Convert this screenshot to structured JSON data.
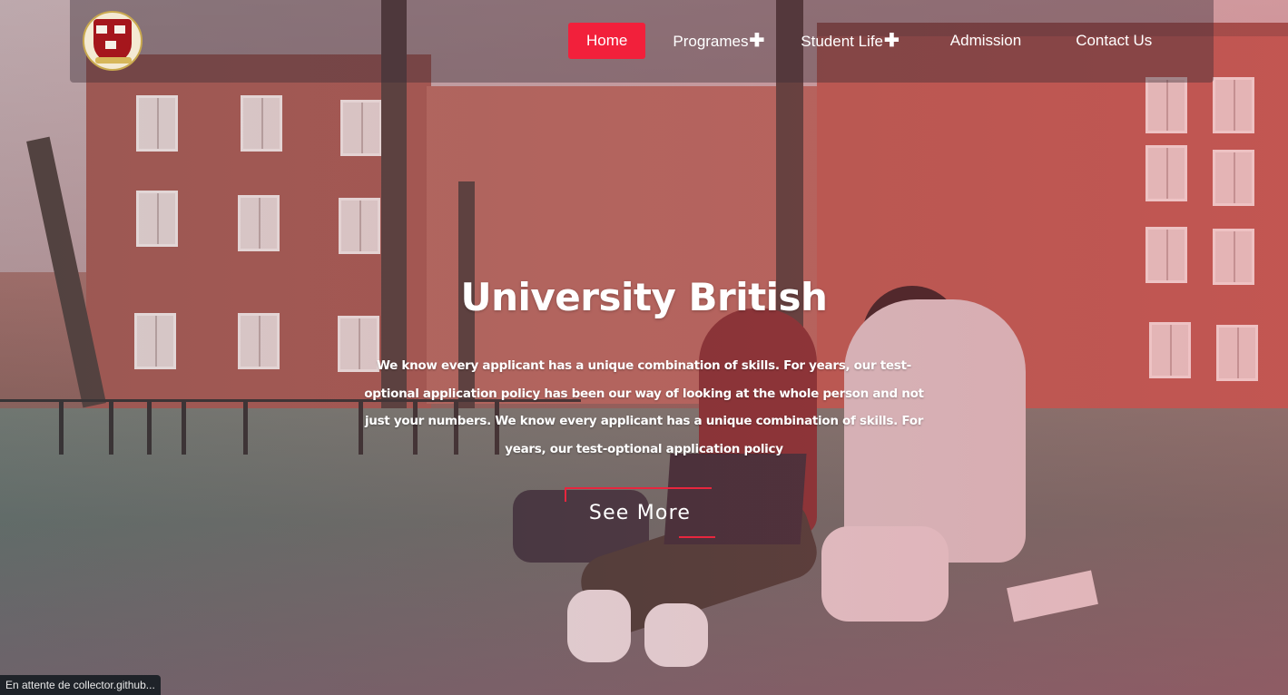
{
  "logo": {
    "text": "HARVARD"
  },
  "nav": {
    "items": [
      {
        "label": "Home",
        "active": true,
        "has_submenu": false
      },
      {
        "label": "Programes",
        "active": false,
        "has_submenu": true
      },
      {
        "label": "Student Life",
        "active": false,
        "has_submenu": true
      },
      {
        "label": "Admission",
        "active": false,
        "has_submenu": false
      },
      {
        "label": "Contact Us",
        "active": false,
        "has_submenu": false
      }
    ],
    "submenu_icon": "plus-icon",
    "plus_glyph": "✚"
  },
  "hero": {
    "title": "University British",
    "text": "We know every applicant has a unique combination of skills. For years, our test-optional application policy has been our way of looking at the whole person and not just your numbers. We know every applicant has a unique combination of skills. For years, our test-optional application policy",
    "button_label": "See More"
  },
  "status": {
    "text": "En attente de collector.github..."
  },
  "colors": {
    "accent": "#f2203b",
    "navbar_bg": "rgba(60,45,55,0.42)",
    "text": "#ffffff",
    "status_bg": "#1f2329"
  }
}
